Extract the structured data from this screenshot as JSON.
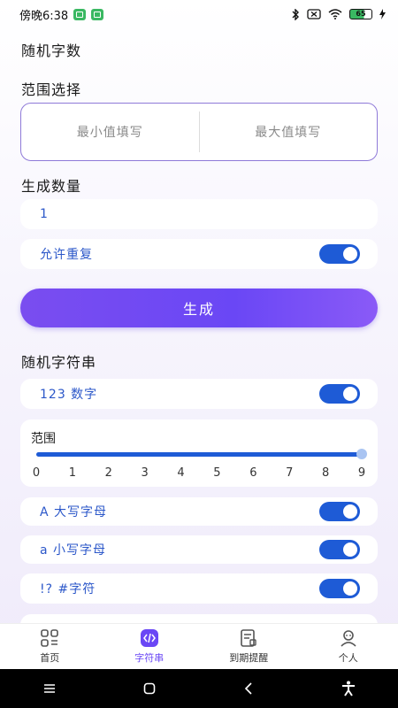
{
  "status_bar": {
    "time": "傍晚6:38",
    "battery": "65"
  },
  "sections": {
    "random_number_title": "随机字数",
    "range_title": "范围选择",
    "count_title": "生成数量",
    "random_string_title": "随机字符串"
  },
  "range": {
    "min_placeholder": "最小值填写",
    "max_placeholder": "最大值填写"
  },
  "count_value": "1",
  "allow_repeat": {
    "label": "允许重复",
    "enabled": true
  },
  "generate_button": "生成",
  "string_options": [
    {
      "label": "123 数字",
      "enabled": true
    },
    {
      "label": "A 大写字母",
      "enabled": true
    },
    {
      "label": "a 小写字母",
      "enabled": true
    },
    {
      "label": "!? #字符",
      "enabled": true
    }
  ],
  "slider": {
    "title": "范围",
    "ticks": [
      "0",
      "1",
      "2",
      "3",
      "4",
      "5",
      "6",
      "7",
      "8",
      "9"
    ],
    "value": 9
  },
  "bottom_nav": [
    {
      "label": "首页",
      "icon": "grid-icon",
      "active": false
    },
    {
      "label": "字符串",
      "icon": "code-icon",
      "active": true
    },
    {
      "label": "到期提醒",
      "icon": "document-icon",
      "active": false
    },
    {
      "label": "个人",
      "icon": "person-icon",
      "active": false
    }
  ],
  "colors": {
    "accent": "#6a47f5",
    "toggle_on": "#1e5bd6",
    "label_blue": "#2b57c9"
  }
}
